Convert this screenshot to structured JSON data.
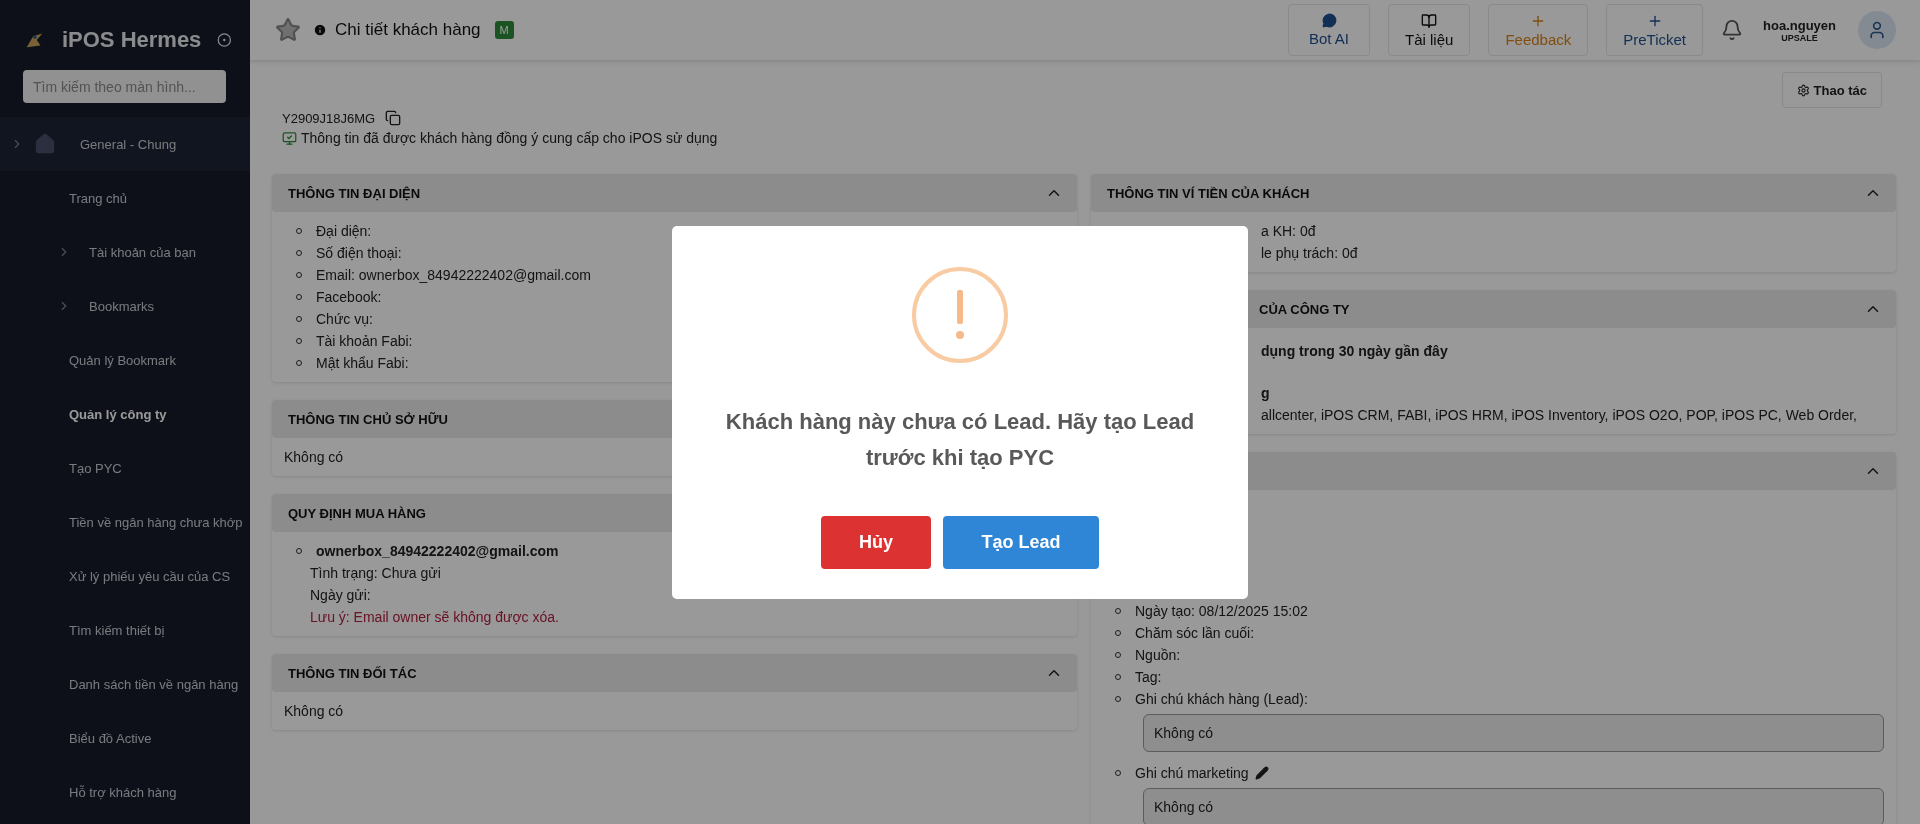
{
  "sidebar": {
    "brand": "iPOS Hermes",
    "search": {
      "placeholder": "Tìm kiếm theo màn hình..."
    },
    "items": [
      {
        "label": "General - Chung",
        "kind": "group",
        "selected": false
      },
      {
        "label": "Trang chủ",
        "kind": "link",
        "selected": false
      },
      {
        "label": "Tài khoản của bạn",
        "kind": "folder",
        "selected": false
      },
      {
        "label": "Bookmarks",
        "kind": "folder",
        "selected": false
      },
      {
        "label": "Quản lý Bookmark",
        "kind": "link",
        "selected": false
      },
      {
        "label": "Quản lý công ty",
        "kind": "link",
        "selected": true
      },
      {
        "label": "Tạo PYC",
        "kind": "link",
        "selected": false
      },
      {
        "label": "Tiền về ngân hàng chưa khớp",
        "kind": "link",
        "selected": false
      },
      {
        "label": "Xử lý phiếu yêu cầu của CS",
        "kind": "link",
        "selected": false
      },
      {
        "label": "Tìm kiếm thiết bị",
        "kind": "link",
        "selected": false
      },
      {
        "label": "Danh sách tiền về ngân hàng",
        "kind": "link",
        "selected": false
      },
      {
        "label": "Biểu đồ Active",
        "kind": "link",
        "selected": false
      },
      {
        "label": "Hỗ trợ khách hàng",
        "kind": "link",
        "selected": false
      }
    ]
  },
  "topbar": {
    "title": "Chi tiết khách hàng",
    "badge": "M",
    "tools": [
      {
        "label": "Bot AI",
        "kind": "chat"
      },
      {
        "label": "Tài liệu",
        "kind": "docs"
      },
      {
        "label": "Feedback",
        "kind": "feedback"
      },
      {
        "label": "PreTicket",
        "kind": "ticket"
      }
    ],
    "user": {
      "name": "hoa.nguyen",
      "role": "UPSALE"
    }
  },
  "page": {
    "action": "Thao tác",
    "customer_id": "Y2909J18J6MG",
    "consent": "Thông tin đã được khách hàng đồng ý cung cấp cho iPOS sử dụng",
    "left_sections": [
      {
        "title": "THÔNG TIN ĐẠI DIỆN",
        "expanded": true,
        "blocks": [
          {
            "kind": "bullet",
            "text": "Đại diện:"
          },
          {
            "kind": "bullet",
            "text": "Số điện thoại:"
          },
          {
            "kind": "bullet",
            "text": "Email: ownerbox_84942222402@gmail.com"
          },
          {
            "kind": "bullet",
            "text": "Facebook:"
          },
          {
            "kind": "bullet",
            "text": "Chức vụ:"
          },
          {
            "kind": "bullet",
            "text": "Tài khoản Fabi:"
          },
          {
            "kind": "bullet",
            "text": "Mật khẩu Fabi:"
          }
        ]
      },
      {
        "title": "THÔNG TIN CHỦ SỞ HỮU",
        "blocks": [
          {
            "kind": "plain",
            "text": "Không có"
          }
        ]
      },
      {
        "title": "QUY ĐỊNH MUA HÀNG",
        "blocks": [
          {
            "kind": "bullet_bold",
            "text": "ownerbox_84942222402@gmail.com"
          },
          {
            "kind": "sub",
            "text": "Tình trạng: Chưa gửi"
          },
          {
            "kind": "sub",
            "text": "Ngày gửi:"
          },
          {
            "kind": "warning",
            "text": "Lưu ý: Email owner sẽ không được xóa."
          }
        ]
      },
      {
        "title": "THÔNG TIN ĐỐI TÁC",
        "expanded": true,
        "blocks": [
          {
            "kind": "plain",
            "text": "Không có"
          }
        ]
      }
    ],
    "right_sections": [
      {
        "title": "THÔNG TIN VÍ TIỀN CỦA KHÁCH",
        "expanded": true,
        "blocks": [
          {
            "kind": "plain",
            "inset": true,
            "text": "a KH: 0đ"
          },
          {
            "kind": "plain",
            "inset": true,
            "text": "le phụ trách: 0đ"
          }
        ]
      },
      {
        "title": "CỦA CÔNG TY",
        "title_inset": true,
        "expanded": true,
        "blocks": [
          {
            "kind": "bold",
            "inset": true,
            "text": "dụng trong 30 ngày gần đây"
          },
          {
            "kind": "bold",
            "inset": true,
            "text": "g"
          },
          {
            "kind": "plain",
            "inset": true,
            "text": "allcenter, iPOS CRM, FABI, iPOS HRM, iPOS Inventory, iPOS O2O, POP, iPOS PC, Web Order,"
          }
        ]
      },
      {
        "expanded": true,
        "blocks": [
          {
            "kind": "bullet",
            "text": "Ngày tạo: 08/12/2025 15:02"
          },
          {
            "kind": "bullet",
            "text": "Chăm sóc lần cuối:"
          },
          {
            "kind": "bullet",
            "text": "Nguồn:"
          },
          {
            "kind": "bullet",
            "text": "Tag:"
          },
          {
            "kind": "bullet",
            "text": "Ghi chú khách hàng (Lead):"
          },
          {
            "kind": "box",
            "text": "Không có"
          },
          {
            "kind": "bullet_edit",
            "text": "Ghi chú marketing"
          },
          {
            "kind": "box",
            "text": "Không có"
          }
        ]
      }
    ]
  },
  "modal": {
    "message": "Khách hàng này chưa có Lead. Hãy tạo Lead trước khi tạo PYC",
    "buttons": [
      {
        "label": "Hủy",
        "kind": "cancel"
      },
      {
        "label": "Tạo Lead",
        "kind": "confirm"
      }
    ]
  }
}
